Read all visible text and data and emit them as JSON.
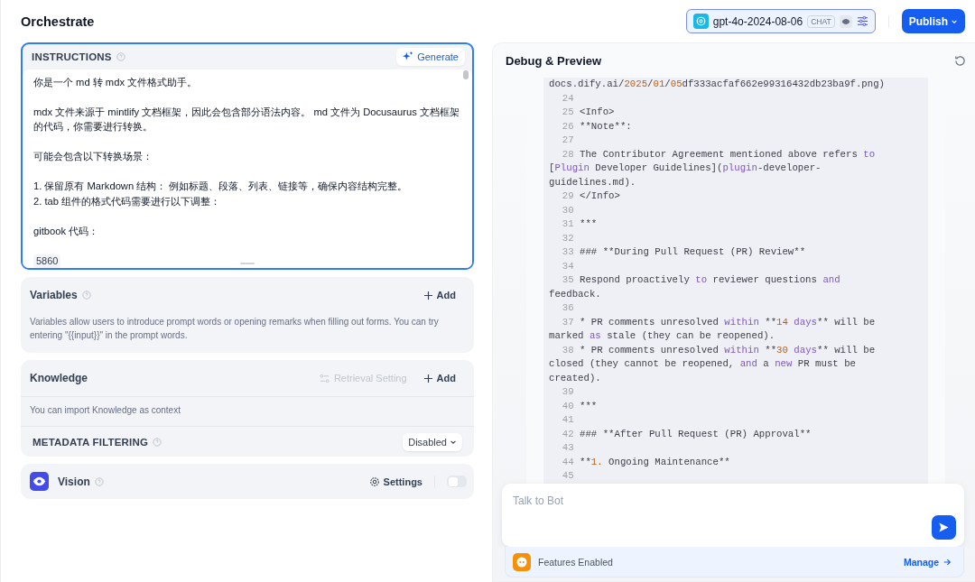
{
  "header": {
    "title": "Orchestrate",
    "model": {
      "name": "gpt-4o-2024-08-06",
      "badge": "CHAT"
    },
    "publish": "Publish"
  },
  "instructions": {
    "title": "INSTRUCTIONS",
    "generate": "Generate",
    "paragraphs": [
      [
        "你是一个 md 转 mdx 文件格式助手。"
      ],
      [
        "mdx 文件来源于 mintlify 文档框架，因此会包含部分语法内容。 md 文件为 Docusaurus 文档框架的代码，你需要进行转换。"
      ],
      [
        "可能会包含以下转换场景："
      ],
      [
        "1. 保留原有 Markdown 结构： 例如标题、段落、列表、链接等，确保内容结构完整。",
        "2. tab 组件的格式代码需要进行以下调整："
      ],
      [
        "gitbook 代码："
      ]
    ],
    "chip": "5860"
  },
  "variables": {
    "title": "Variables",
    "add": "Add",
    "description": "Variables allow users to introduce prompt words or opening remarks when filling out forms. You can try entering \"{{input}}\" in the prompt words."
  },
  "knowledge": {
    "title": "Knowledge",
    "retrieval": {
      "label": "Retrieval Setting",
      "disabled": true
    },
    "add": "Add",
    "description": "You can import Knowledge as context",
    "metadata": {
      "label": "METADATA FILTERING",
      "value": "Disabled"
    }
  },
  "vision": {
    "title": "Vision",
    "settings": "Settings",
    "enabled": false
  },
  "preview": {
    "title": "Debug & Preview",
    "code_lines": [
      {
        "segments": [
          {
            "t": "docs.dify.ai/",
            "kind": "plain"
          },
          {
            "t": "2025",
            "kind": "number"
          },
          {
            "t": "/",
            "kind": "plain"
          },
          {
            "t": "01",
            "kind": "number"
          },
          {
            "t": "/",
            "kind": "plain"
          },
          {
            "t": "05",
            "kind": "number"
          },
          {
            "t": "df333acfaf662e99316432db23ba9f.png)",
            "kind": "plain"
          }
        ]
      },
      {
        "number": "24"
      },
      {
        "number": "25",
        "segments": [
          {
            "t": "<Info>",
            "kind": "plain"
          }
        ]
      },
      {
        "number": "26",
        "segments": [
          {
            "t": "**Note**:",
            "kind": "plain"
          }
        ]
      },
      {
        "number": "27"
      },
      {
        "number": "28",
        "segments": [
          {
            "t": "The Contributor Agreement mentioned above refers ",
            "kind": "plain"
          },
          {
            "t": "to",
            "kind": "keyword"
          },
          {
            "t": " [",
            "kind": "plain"
          },
          {
            "t": "Plugin",
            "kind": "keyword"
          },
          {
            "t": " Developer Guidelines](",
            "kind": "plain"
          },
          {
            "t": "plugin",
            "kind": "keyword"
          },
          {
            "t": "-developer-guidelines.md).",
            "kind": "plain"
          }
        ]
      },
      {
        "number": "29",
        "segments": [
          {
            "t": "</Info>",
            "kind": "plain"
          }
        ]
      },
      {
        "number": "30"
      },
      {
        "number": "31",
        "segments": [
          {
            "t": "***",
            "kind": "plain"
          }
        ]
      },
      {
        "number": "32"
      },
      {
        "number": "33",
        "segments": [
          {
            "t": "### **During Pull Request (PR) Review**",
            "kind": "plain"
          }
        ]
      },
      {
        "number": "34"
      },
      {
        "number": "35",
        "segments": [
          {
            "t": "Respond proactively ",
            "kind": "plain"
          },
          {
            "t": "to",
            "kind": "keyword"
          },
          {
            "t": " reviewer questions ",
            "kind": "plain"
          },
          {
            "t": "and",
            "kind": "keyword"
          },
          {
            "t": " feedback.",
            "kind": "plain"
          }
        ]
      },
      {
        "number": "36"
      },
      {
        "number": "37",
        "segments": [
          {
            "t": "* PR comments unresolved ",
            "kind": "plain"
          },
          {
            "t": "within",
            "kind": "keyword"
          },
          {
            "t": " **",
            "kind": "plain"
          },
          {
            "t": "14",
            "kind": "number"
          },
          {
            "t": " days",
            "kind": "keyword"
          },
          {
            "t": "** will be marked ",
            "kind": "plain"
          },
          {
            "t": "as",
            "kind": "keyword"
          },
          {
            "t": " stale (they can be reopened).",
            "kind": "plain"
          }
        ]
      },
      {
        "number": "38",
        "segments": [
          {
            "t": "* PR comments unresolved ",
            "kind": "plain"
          },
          {
            "t": "within",
            "kind": "keyword"
          },
          {
            "t": " **",
            "kind": "plain"
          },
          {
            "t": "30",
            "kind": "number"
          },
          {
            "t": " days",
            "kind": "keyword"
          },
          {
            "t": "** will be closed (they cannot be reopened, ",
            "kind": "plain"
          },
          {
            "t": "and",
            "kind": "keyword"
          },
          {
            "t": " a ",
            "kind": "plain"
          },
          {
            "t": "new",
            "kind": "keyword"
          },
          {
            "t": " PR must be created).",
            "kind": "plain"
          }
        ]
      },
      {
        "number": "39"
      },
      {
        "number": "40",
        "segments": [
          {
            "t": "***",
            "kind": "plain"
          }
        ]
      },
      {
        "number": "41"
      },
      {
        "number": "42",
        "segments": [
          {
            "t": "### **After Pull Request (PR) Approval**",
            "kind": "plain"
          }
        ]
      },
      {
        "number": "43"
      },
      {
        "number": "44",
        "segments": [
          {
            "t": "**",
            "kind": "plain"
          },
          {
            "t": "1.",
            "kind": "number"
          },
          {
            "t": " Ongoing Maintenance**",
            "kind": "plain"
          }
        ]
      },
      {
        "number": "45"
      }
    ],
    "chat_input": {
      "placeholder": "Talk to Bot"
    },
    "features": {
      "label": "Features Enabled",
      "manage": "Manage"
    }
  }
}
